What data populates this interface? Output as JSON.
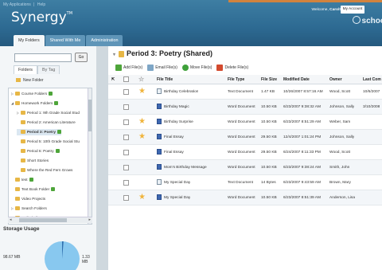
{
  "header": {
    "toplinks": [
      "My Applications",
      "|",
      "Help"
    ],
    "app_name": "Synergy",
    "tm": "TM",
    "welcome_prefix": "Welcome,",
    "welcome_user": "Carol!",
    "my_account": "My Account",
    "school_logo": "schoo",
    "tabs": [
      {
        "label": "My Folders",
        "active": true
      },
      {
        "label": "Shared With Me",
        "active": false
      },
      {
        "label": "Administration",
        "active": false
      }
    ]
  },
  "search": {
    "value": "",
    "go_label": "Go"
  },
  "folder_tabs": [
    {
      "label": "Folders",
      "active": true
    },
    {
      "label": "By Tag",
      "active": false
    }
  ],
  "new_folder_label": "New Folder",
  "tree": [
    {
      "label": "Course Folders",
      "toggle": "▷",
      "indent": 0,
      "shared": true
    },
    {
      "label": "Homework Folders",
      "toggle": "◢",
      "indent": 0,
      "shared": true
    },
    {
      "label": "Period 1: 9th Grade Social Stud",
      "toggle": "▷",
      "indent": 1,
      "shared": false
    },
    {
      "label": "Period 2: American Literature",
      "toggle": "",
      "indent": 1,
      "shared": false
    },
    {
      "label": "Period 3: Poetry",
      "toggle": "",
      "indent": 1,
      "shared": true,
      "selected": true
    },
    {
      "label": "Period 5: 10th Grade Social Stu",
      "toggle": "",
      "indent": 1,
      "shared": false
    },
    {
      "label": "Period 6: Poetry",
      "toggle": "",
      "indent": 1,
      "shared": true
    },
    {
      "label": "Short Stories",
      "toggle": "",
      "indent": 1,
      "shared": false
    },
    {
      "label": "Where the Red Fern Grows",
      "toggle": "",
      "indent": 1,
      "shared": false
    },
    {
      "label": "test",
      "toggle": "",
      "indent": 0,
      "shared": true
    },
    {
      "label": "Text Book Folder",
      "toggle": "",
      "indent": 0,
      "shared": true
    },
    {
      "label": "Video Projects",
      "toggle": "",
      "indent": 0,
      "shared": false
    },
    {
      "label": "Search Folders",
      "toggle": "▷",
      "indent": 0,
      "shared": false
    },
    {
      "label": "Mailed Files",
      "toggle": "",
      "indent": 0,
      "shared": false
    }
  ],
  "storage": {
    "title": "Storage Usage",
    "used": "98.67 MB",
    "free": "1.33 MB",
    "used_fraction": 0.9867,
    "color_used": "#88c8ef",
    "color_free": "#2f6fae"
  },
  "main": {
    "folder_title": "Period 3: Poetry (Shared)",
    "toolbar": {
      "add": "Add File(s)",
      "email": "Email File(s)",
      "move": "Move File(s)",
      "delete": "Delete File(s)"
    },
    "columns": {
      "title": "File Title",
      "type": "File Type",
      "size": "File Size",
      "modified": "Modified Date",
      "owner": "Owner",
      "last_comment": "Last Com"
    },
    "rows": [
      {
        "starred": true,
        "title": "Birthday Celebration",
        "kind": "text",
        "type": "Text Document",
        "size": "1.47 KB",
        "modified": "10/26/2007 8:57:16 AM",
        "owner": "Wood, Scott",
        "last_comment": "10/6/2007"
      },
      {
        "starred": false,
        "title": "Birthday Magic",
        "kind": "word",
        "type": "Word Document",
        "size": "10.50 KB",
        "modified": "6/23/2007 9:38:32 AM",
        "owner": "Johnson, Sally",
        "last_comment": "3/10/2008"
      },
      {
        "starred": true,
        "title": "Birthday Surprise",
        "kind": "word",
        "type": "Word Document",
        "size": "10.50 KB",
        "modified": "6/23/2007 8:51:29 AM",
        "owner": "Weber, Sam",
        "last_comment": ""
      },
      {
        "starred": true,
        "title": "Final Essay",
        "kind": "word",
        "type": "Word Document",
        "size": "29.50 KB",
        "modified": "12/4/2007 1:01:24 PM",
        "owner": "Johnson, Sally",
        "last_comment": ""
      },
      {
        "starred": false,
        "title": "Final Essay",
        "kind": "word",
        "type": "Word Document",
        "size": "29.50 KB",
        "modified": "6/24/2007 8:11:33 PM",
        "owner": "Wood, Scott",
        "last_comment": ""
      },
      {
        "starred": false,
        "title": "Mom's Birthday Message",
        "kind": "word",
        "type": "Word Document",
        "size": "10.50 KB",
        "modified": "6/23/2007 9:38:24 AM",
        "owner": "Smith, John",
        "last_comment": ""
      },
      {
        "starred": false,
        "title": "My Special Day",
        "kind": "text",
        "type": "Text Document",
        "size": "14 Bytes",
        "modified": "6/23/2007 9:43:59 AM",
        "owner": "Brown, Mary",
        "last_comment": ""
      },
      {
        "starred": true,
        "title": "My Special Day",
        "kind": "word",
        "type": "Word Document",
        "size": "10.50 KB",
        "modified": "6/23/2007 8:51:39 AM",
        "owner": "Anderson, Lisa",
        "last_comment": ""
      }
    ]
  }
}
